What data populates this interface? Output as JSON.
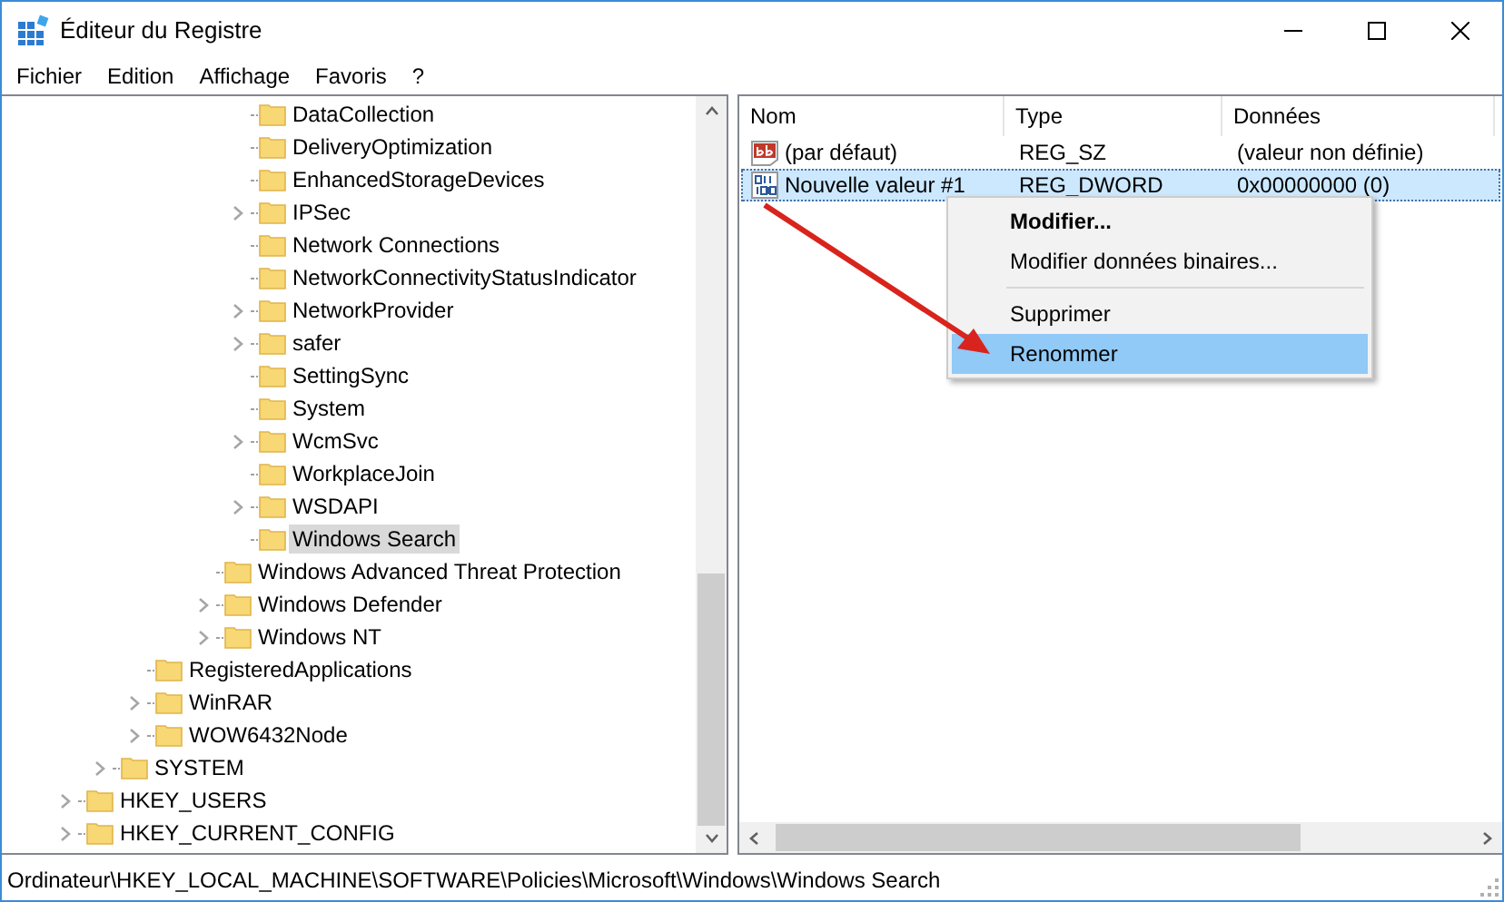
{
  "window": {
    "title": "Éditeur du Registre"
  },
  "menu": [
    "Fichier",
    "Edition",
    "Affichage",
    "Favoris",
    "?"
  ],
  "tree": [
    {
      "children": [
        {
          "children": [
            {
              "children": [
                {
                  "children": [
                    {
                      "children": [
                        {
                          "label": "DataCollection",
                          "expandable": false,
                          "selected": false
                        },
                        {
                          "label": "DeliveryOptimization",
                          "expandable": false,
                          "selected": false
                        },
                        {
                          "label": "EnhancedStorageDevices",
                          "expandable": false,
                          "selected": false
                        },
                        {
                          "label": "IPSec",
                          "expandable": true,
                          "selected": false
                        },
                        {
                          "label": "Network Connections",
                          "expandable": false,
                          "selected": false
                        },
                        {
                          "label": "NetworkConnectivityStatusIndicator",
                          "expandable": false,
                          "selected": false
                        },
                        {
                          "label": "NetworkProvider",
                          "expandable": true,
                          "selected": false
                        },
                        {
                          "label": "safer",
                          "expandable": true,
                          "selected": false
                        },
                        {
                          "label": "SettingSync",
                          "expandable": false,
                          "selected": false
                        },
                        {
                          "label": "System",
                          "expandable": false,
                          "selected": false
                        },
                        {
                          "label": "WcmSvc",
                          "expandable": true,
                          "selected": false
                        },
                        {
                          "label": "WorkplaceJoin",
                          "expandable": false,
                          "selected": false
                        },
                        {
                          "label": "WSDAPI",
                          "expandable": true,
                          "selected": false
                        },
                        {
                          "label": "Windows Search",
                          "expandable": false,
                          "selected": true
                        }
                      ]
                    },
                    {
                      "label": "Windows Advanced Threat Protection",
                      "expandable": false,
                      "selected": false
                    },
                    {
                      "label": "Windows Defender",
                      "expandable": true,
                      "selected": false
                    },
                    {
                      "label": "Windows NT",
                      "expandable": true,
                      "selected": false
                    }
                  ]
                }
              ]
            },
            {
              "label": "RegisteredApplications",
              "expandable": false,
              "selected": false
            },
            {
              "label": "WinRAR",
              "expandable": true,
              "selected": false
            },
            {
              "label": "WOW6432Node",
              "expandable": true,
              "selected": false
            }
          ]
        },
        {
          "label": "SYSTEM",
          "expandable": true,
          "selected": false
        }
      ]
    },
    {
      "label": "HKEY_USERS",
      "expandable": true,
      "selected": false
    },
    {
      "label": "HKEY_CURRENT_CONFIG",
      "expandable": true,
      "selected": false
    }
  ],
  "values": {
    "columns": [
      "Nom",
      "Type",
      "Données"
    ],
    "rows": [
      {
        "kind": "string",
        "name": "(par défaut)",
        "type": "REG_SZ",
        "data": "(valeur non définie)",
        "selected": false
      },
      {
        "kind": "binary",
        "name": "Nouvelle valeur #1",
        "type": "REG_DWORD",
        "data": "0x00000000 (0)",
        "selected": true
      }
    ]
  },
  "context_menu": {
    "groups": [
      [
        {
          "label": "Modifier...",
          "default": true,
          "selected": false
        },
        {
          "label": "Modifier données binaires...",
          "default": false,
          "selected": false
        }
      ],
      [
        {
          "label": "Supprimer",
          "default": false,
          "selected": false
        },
        {
          "label": "Renommer",
          "default": false,
          "selected": true
        }
      ]
    ]
  },
  "status_bar": "Ordinateur\\HKEY_LOCAL_MACHINE\\SOFTWARE\\Policies\\Microsoft\\Windows\\Windows Search"
}
